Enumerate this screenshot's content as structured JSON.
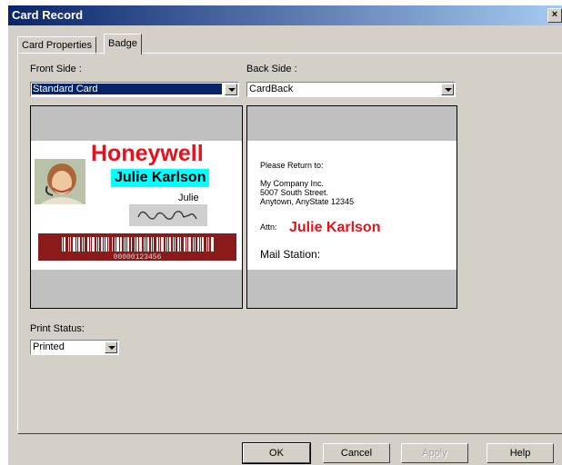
{
  "window": {
    "title": "Card Record",
    "close_glyph": "×"
  },
  "tabs": [
    {
      "label": "Card Properties",
      "active": false
    },
    {
      "label": "Badge",
      "active": true
    }
  ],
  "front_side": {
    "label": "Front Side :",
    "value": "Standard Card"
  },
  "back_side": {
    "label": "Back Side :",
    "value": "CardBack"
  },
  "front_card": {
    "brand": "Honeywell",
    "name": "Julie Karlson",
    "first_name": "Julie",
    "barcode_number": "00000123456",
    "brand_color": "#e8101a",
    "name_highlight_color": "#00ffff",
    "barcode_color": "#8b1a1a"
  },
  "back_card": {
    "return_heading": "Please Return to:",
    "address_lines": [
      "My Company Inc.",
      "5007 South Street.",
      "Anytown, AnyState 12345"
    ],
    "attn_label": "Attn:",
    "attn_name": "Julie Karlson",
    "mail_station": "Mail Station:",
    "attn_color": "#e8101a"
  },
  "print_status": {
    "label": "Print Status:",
    "value": "Printed"
  },
  "buttons": {
    "ok": "OK",
    "cancel": "Cancel",
    "apply": "Apply",
    "help": "Help"
  }
}
